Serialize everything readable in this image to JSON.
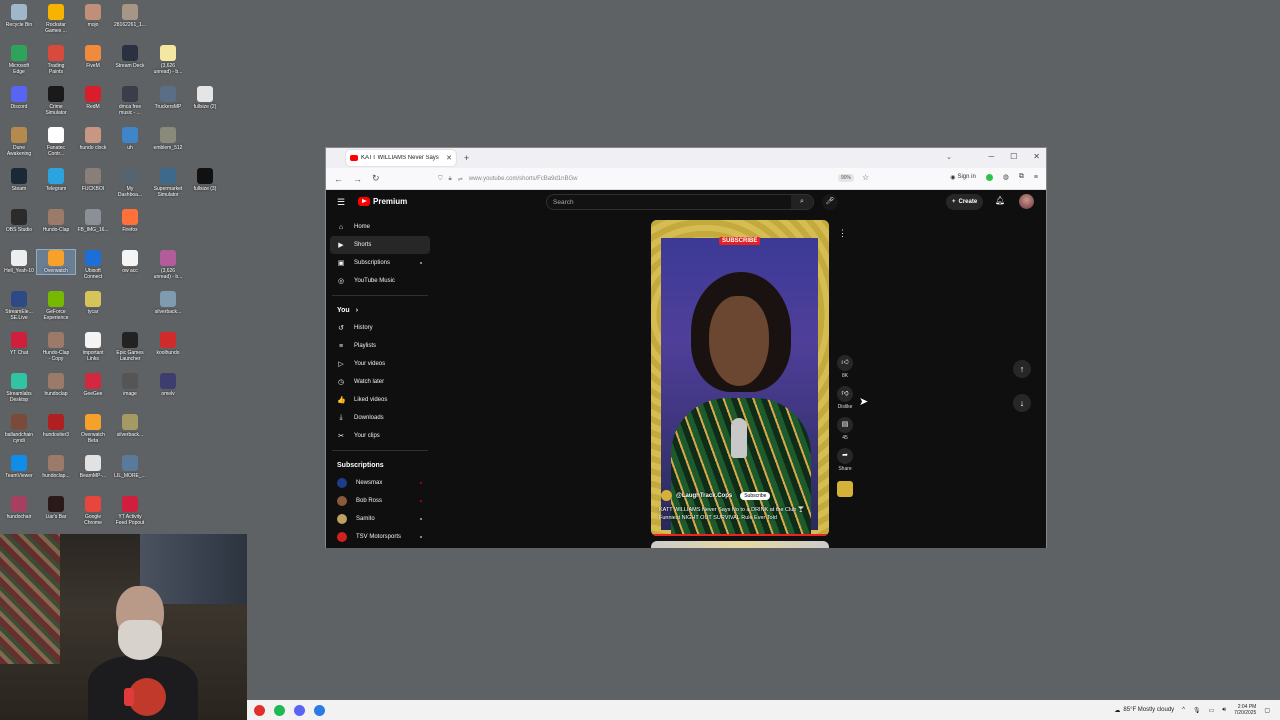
{
  "desktop": {
    "icons": [
      {
        "label": "Recycle Bin",
        "color": "#9fb7c9"
      },
      {
        "label": "Rockstar\nGames ...",
        "color": "#f6b300"
      },
      {
        "label": "mojo",
        "color": "#c08f7a"
      },
      {
        "label": "28162261_1...",
        "color": "#a79586"
      },
      {
        "label": "Microsoft\nEdge",
        "color": "#2fa35a"
      },
      {
        "label": "Trading\nPaints",
        "color": "#d74a3c"
      },
      {
        "label": "FiveM",
        "color": "#f08a3c"
      },
      {
        "label": "Stream Deck",
        "color": "#2b3140"
      },
      {
        "label": "(3,626\nunread) - b...",
        "color": "#f3e7a2"
      },
      {
        "label": "Discord",
        "color": "#5865f2"
      },
      {
        "label": "Crime\nSimulator",
        "color": "#1a1a1a"
      },
      {
        "label": "RedM",
        "color": "#d81e2a"
      },
      {
        "label": "dmca free\nmusic - ...",
        "color": "#3d3d49"
      },
      {
        "label": "TruckersMP",
        "color": "#5a6e86"
      },
      {
        "label": "fullsize (2)",
        "color": "#e5e5e5"
      },
      {
        "label": "Dune\nAwakening",
        "color": "#b48a4e"
      },
      {
        "label": "Fanatec\nContr...",
        "color": "#ffffff"
      },
      {
        "label": "hundo clock",
        "color": "#c89784"
      },
      {
        "label": "uh",
        "color": "#3f86c8"
      },
      {
        "label": "emblem_512",
        "color": "#8a8a7a"
      },
      {
        "label": "Steam",
        "color": "#1b2838"
      },
      {
        "label": "Telegram",
        "color": "#2aa3df"
      },
      {
        "label": "FUCKBOI",
        "color": "#8a7e79"
      },
      {
        "label": "My\nDashboa...",
        "color": "#566470"
      },
      {
        "label": "Supermarket\nSimulator",
        "color": "#3d6a8a"
      },
      {
        "label": "fullsize (3)",
        "color": "#111111"
      },
      {
        "label": "OBS Studio",
        "color": "#2b2b2b"
      },
      {
        "label": "Hundo-Clap",
        "color": "#9b7a6a"
      },
      {
        "label": "FB_IMG_16...",
        "color": "#8b8f96"
      },
      {
        "label": "Firefox",
        "color": "#ff7139"
      },
      {
        "label": "Hell_Yeah-10",
        "color": "#eeeeee"
      },
      {
        "label": "Overwatch",
        "color": "#f5a12c"
      },
      {
        "label": "Ubisoft\nConnect",
        "color": "#1e6ed8"
      },
      {
        "label": "ow acc",
        "color": "#f4f4f4"
      },
      {
        "label": "(3,626\nunread) - b...",
        "color": "#b35c9c"
      },
      {
        "label": "StreamEle...\nSE.Live",
        "color": "#2d4a86"
      },
      {
        "label": "GeForce\nExperience",
        "color": "#76b900"
      },
      {
        "label": "tycar",
        "color": "#d6c45a"
      },
      {
        "label": "silverback...",
        "color": "#7f9bb0"
      },
      {
        "label": "YT Chat",
        "color": "#d01f3c"
      },
      {
        "label": "Hundo-Clap\n- Copy",
        "color": "#9b7a6a"
      },
      {
        "label": "Important\nLinks",
        "color": "#f4f4f4"
      },
      {
        "label": "Epic Games\nLauncher",
        "color": "#222222"
      },
      {
        "label": "koolhundo",
        "color": "#d02a2a"
      },
      {
        "label": "Streamlabs\nDesktop",
        "color": "#31c3a2"
      },
      {
        "label": "hundoclap",
        "color": "#9b7a6a"
      },
      {
        "label": "GeeGee",
        "color": "#d22840"
      },
      {
        "label": "image",
        "color": "#555555"
      },
      {
        "label": "omelv",
        "color": "#3d3d70"
      },
      {
        "label": "ballandchain\ncyndi",
        "color": "#7a4a3a"
      },
      {
        "label": "hundostier3",
        "color": "#b02020"
      },
      {
        "label": "Overwatch\nBeta",
        "color": "#f5a12c"
      },
      {
        "label": "silverback...",
        "color": "#a39a64"
      },
      {
        "label": "TeamViewer",
        "color": "#0e8ee9"
      },
      {
        "label": "hundoclap...",
        "color": "#9b7a6a"
      },
      {
        "label": "BeamMP-...",
        "color": "#e2e2e2"
      },
      {
        "label": "LIL_MORE_...",
        "color": "#5a7a9a"
      },
      {
        "label": "hundochair",
        "color": "#a44060"
      },
      {
        "label": "Liar's Bar",
        "color": "#2a1a1a"
      },
      {
        "label": "Google\nChrome",
        "color": "#e8453c"
      },
      {
        "label": "YT Activity\nFeed Popout",
        "color": "#d01f3c"
      }
    ]
  },
  "browser": {
    "tab_title": "KATT WILLIAMS Never Says",
    "new_tab": "+",
    "url": "www.youtube.com/shorts/FcBa9d1nBGw",
    "zoom": "90%",
    "sign_in": "Sign in"
  },
  "youtube": {
    "brand": "Premium",
    "search_placeholder": "Search",
    "create_label": "Create",
    "nav": [
      {
        "label": "Home",
        "icon": "⌂"
      },
      {
        "label": "Shorts",
        "icon": "▶"
      },
      {
        "label": "Subscriptions",
        "icon": "▣"
      },
      {
        "label": "YouTube Music",
        "icon": "◎"
      }
    ],
    "you_header": "You",
    "you_items": [
      {
        "label": "History",
        "icon": "↺"
      },
      {
        "label": "Playlists",
        "icon": "≡"
      },
      {
        "label": "Your videos",
        "icon": "▷"
      },
      {
        "label": "Watch later",
        "icon": "◷"
      },
      {
        "label": "Liked videos",
        "icon": "👍"
      },
      {
        "label": "Downloads",
        "icon": "⤓"
      },
      {
        "label": "Your clips",
        "icon": "✂"
      }
    ],
    "subs_header": "Subscriptions",
    "subscriptions": [
      {
        "label": "Newsmax",
        "color": "#1c3d8a"
      },
      {
        "label": "Bob Ross",
        "color": "#8a5a3a"
      },
      {
        "label": "Samito",
        "color": "#c0a060"
      },
      {
        "label": "TSV Motorsports",
        "color": "#d02020"
      }
    ],
    "short": {
      "subscribe_badge": "SUBSCRIBE",
      "channel_handle": "@LaughTrack.Cops",
      "subscribe_button": "Subscribe",
      "caption": "KATT WILLIAMS Never Says No to a DRINK at the Club 🍸 Funniest NIGHT OUT SURVIVAL Rule Ever Told"
    },
    "actions": {
      "like_count": "8K",
      "dislike_label": "Dislike",
      "comment_count": "45",
      "share_label": "Share"
    }
  },
  "taskbar": {
    "apps": [
      {
        "name": "recording-app",
        "color": "#e0302a"
      },
      {
        "name": "spotify-app",
        "color": "#1db954"
      },
      {
        "name": "discord-app",
        "color": "#5865f2"
      },
      {
        "name": "browser-app",
        "color": "#2a7be4"
      }
    ],
    "weather": "85°F  Mostly cloudy",
    "time": "2:04 PM",
    "date": "7/20/2025"
  }
}
